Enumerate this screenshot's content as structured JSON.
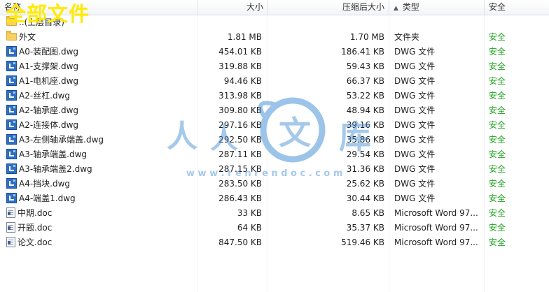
{
  "overlay": {
    "title": "全部文件"
  },
  "columns": {
    "name": "名称",
    "size": "大小",
    "compressed": "压缩后大小",
    "type": "类型",
    "safety": "安全"
  },
  "colors": {
    "safe": "#1fa21f",
    "watermark_title": "#ffea00",
    "watermark_logo": "#4d94d8"
  },
  "watermark": {
    "text": "人人文库",
    "url": "w w w . r e n r e n d o c . c o m"
  },
  "files": [
    {
      "icon": "folder-icon",
      "kind": "folder",
      "name": "..(上层目录)",
      "size": "",
      "compressed": "",
      "type": "",
      "safety": ""
    },
    {
      "icon": "folder-icon",
      "kind": "folder",
      "name": "外文",
      "size": "1.81 MB",
      "compressed": "1.70 MB",
      "type": "文件夹",
      "safety": "安全"
    },
    {
      "icon": "dwg-file-icon",
      "kind": "dwg",
      "name": "A0-装配图.dwg",
      "size": "454.01 KB",
      "compressed": "186.41 KB",
      "type": "DWG 文件",
      "safety": "安全"
    },
    {
      "icon": "dwg-file-icon",
      "kind": "dwg",
      "name": "A1-支撑架.dwg",
      "size": "319.88 KB",
      "compressed": "59.43 KB",
      "type": "DWG 文件",
      "safety": "安全"
    },
    {
      "icon": "dwg-file-icon",
      "kind": "dwg",
      "name": "A1-电机座.dwg",
      "size": "94.46 KB",
      "compressed": "66.37 KB",
      "type": "DWG 文件",
      "safety": "安全"
    },
    {
      "icon": "dwg-file-icon",
      "kind": "dwg",
      "name": "A2-丝杠.dwg",
      "size": "313.98 KB",
      "compressed": "53.22 KB",
      "type": "DWG 文件",
      "safety": "安全"
    },
    {
      "icon": "dwg-file-icon",
      "kind": "dwg",
      "name": "A2-轴承座.dwg",
      "size": "309.80 KB",
      "compressed": "48.94 KB",
      "type": "DWG 文件",
      "safety": "安全"
    },
    {
      "icon": "dwg-file-icon",
      "kind": "dwg",
      "name": "A2-连接体.dwg",
      "size": "297.16 KB",
      "compressed": "39.16 KB",
      "type": "DWG 文件",
      "safety": "安全"
    },
    {
      "icon": "dwg-file-icon",
      "kind": "dwg",
      "name": "A3-左侧轴承端盖.dwg",
      "size": "292.50 KB",
      "compressed": "35.86 KB",
      "type": "DWG 文件",
      "safety": "安全"
    },
    {
      "icon": "dwg-file-icon",
      "kind": "dwg",
      "name": "A3-轴承端盖.dwg",
      "size": "287.11 KB",
      "compressed": "29.54 KB",
      "type": "DWG 文件",
      "safety": "安全"
    },
    {
      "icon": "dwg-file-icon",
      "kind": "dwg",
      "name": "A3-轴承端盖2.dwg",
      "size": "287.15 KB",
      "compressed": "31.36 KB",
      "type": "DWG 文件",
      "safety": "安全"
    },
    {
      "icon": "dwg-file-icon",
      "kind": "dwg",
      "name": "A4-挡块.dwg",
      "size": "283.50 KB",
      "compressed": "25.62 KB",
      "type": "DWG 文件",
      "safety": "安全"
    },
    {
      "icon": "dwg-file-icon",
      "kind": "dwg",
      "name": "A4-端盖1.dwg",
      "size": "286.43 KB",
      "compressed": "30.44 KB",
      "type": "DWG 文件",
      "safety": "安全"
    },
    {
      "icon": "doc-file-icon",
      "kind": "doc",
      "name": "中期.doc",
      "size": "33 KB",
      "compressed": "8.65 KB",
      "type": "Microsoft Word 97...",
      "safety": "安全"
    },
    {
      "icon": "doc-file-icon",
      "kind": "doc",
      "name": "开题.doc",
      "size": "64 KB",
      "compressed": "35.37 KB",
      "type": "Microsoft Word 97...",
      "safety": "安全"
    },
    {
      "icon": "doc-file-icon",
      "kind": "doc",
      "name": "论文.doc",
      "size": "847.50 KB",
      "compressed": "519.46 KB",
      "type": "Microsoft Word 97...",
      "safety": "安全"
    }
  ]
}
